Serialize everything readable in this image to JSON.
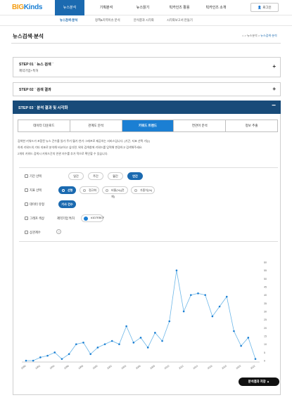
{
  "header": {
    "logo_a": "BIG",
    "logo_b": "Kinds",
    "nav": [
      "뉴스분석",
      "기획분석",
      "뉴스읽기",
      "빅카인즈 활용",
      "빅카인즈 소개"
    ],
    "active_nav": 0,
    "login": "로그인"
  },
  "subnav": [
    "뉴스검색·분석",
    "정책&지역이슈 분석",
    "분석결과 시각화",
    "시각화보고서 만들기"
  ],
  "page": {
    "title": "뉴스검색·분석",
    "breadcrumb": [
      "⌂",
      "뉴스분석",
      "뉴스검색·분석"
    ]
  },
  "step1": {
    "title": "STEP 01 ˙ 뉴스 검색 ˙",
    "subtitle": "제약기업+특허"
  },
  "step2": {
    "title": "STEP 02 ˙ 검색 결과"
  },
  "step3": {
    "title": "STEP 03 ˙ 분석 결과 및 시각화"
  },
  "tabs": [
    "데이터 다운로드",
    "관계도 분석",
    "키워드 트렌드",
    "연관어 분석",
    "정보 추출"
  ],
  "active_tab": 2,
  "description": [
    "검색한 키워드가 포함된 뉴스 건수를 일기·주기·월기·연기·그래프로 제공하는 서비스입니다. (기간, 지표 선택 가능)",
    "하게 키워드의 기타 지표로 분석해 비교하고 싶다면, 위의 검색창에 키워드를 입력해 변경하고 검색해주세요.",
    "2개의 키워드 검색시 키워드간의 연관 지수를 추가 적으로 확인할 수 있습니다."
  ],
  "options": {
    "period": {
      "label": "기간 선택",
      "items": [
        "일간",
        "주간",
        "월간",
        "연간"
      ],
      "selected": 3
    },
    "index": {
      "label": "지표 선택",
      "items": [
        "선형",
        "정규화",
        "비율(%)(전체)",
        "가중치(%)"
      ],
      "selected": 0
    },
    "data": {
      "label": "데이터 유형",
      "items": [
        "기사 건수"
      ],
      "selected": 0
    },
    "graph": {
      "label": "그래프 색상",
      "sub": "제약기업 특허",
      "color_label": "#1D7EBCF",
      "color": "#1b7fd3"
    },
    "corr": {
      "label": "상관계수"
    }
  },
  "chart_data": {
    "type": "line",
    "series": [
      {
        "values": [
          0,
          0,
          2,
          3,
          5,
          1,
          4,
          10,
          11,
          4,
          8,
          10,
          12,
          10,
          21,
          11,
          14,
          8,
          17,
          12,
          24,
          55,
          30,
          40,
          41,
          40,
          27,
          33,
          39,
          18,
          9,
          14,
          1
        ]
      }
    ],
    "x_tick_labels": [
      "1990",
      "",
      "1992",
      "",
      "1994",
      "",
      "1996",
      "",
      "1998",
      "",
      "2000",
      "",
      "2002",
      "",
      "2004",
      "",
      "2006",
      "",
      "2008",
      "",
      "2010",
      "",
      "2012",
      "",
      "2014",
      "",
      "2016",
      "",
      "2018",
      "",
      "2020",
      "",
      "2022"
    ],
    "y_tick_labels": [
      "60",
      "55",
      "50",
      "45",
      "40",
      "35",
      "30",
      "25",
      "20",
      "15",
      "10",
      "5",
      "0"
    ],
    "ylim": [
      0,
      60
    ],
    "grid": false,
    "color": "#6db7e8",
    "point_color": "#1b7fd3"
  },
  "save_button": "분석결과 저장"
}
